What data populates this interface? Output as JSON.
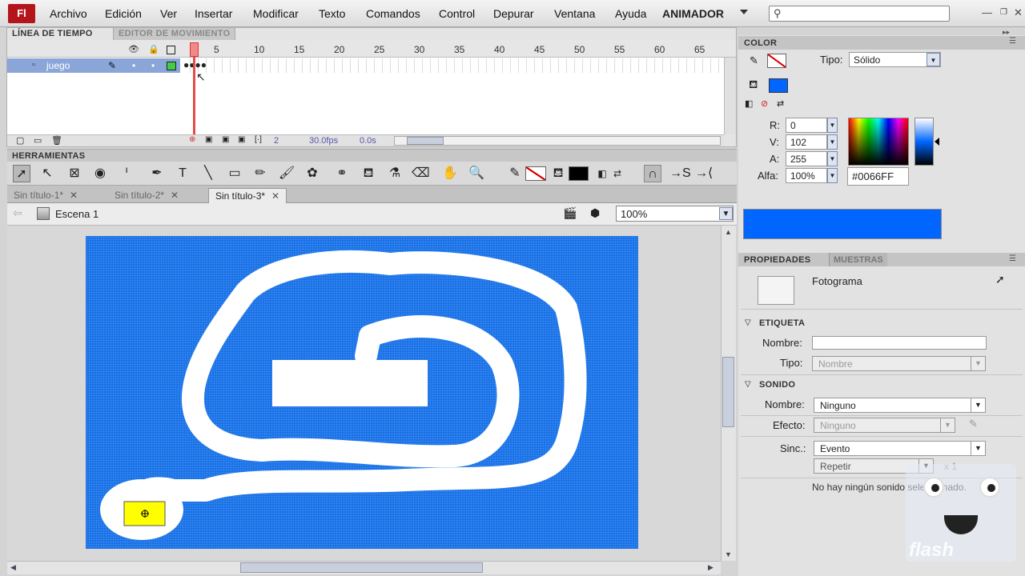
{
  "app": {
    "logo": "Fl",
    "workspace": "ANIMADOR"
  },
  "menu": [
    "Archivo",
    "Edición",
    "Ver",
    "Insertar",
    "Modificar",
    "Texto",
    "Comandos",
    "Control",
    "Depurar",
    "Ventana",
    "Ayuda"
  ],
  "timeline": {
    "tabs": [
      "LÍNEA DE TIEMPO",
      "EDITOR DE MOVIMIENTO"
    ],
    "frame_numbers": [
      "5",
      "10",
      "15",
      "20",
      "25",
      "30",
      "35",
      "40",
      "45",
      "50",
      "55",
      "60",
      "65"
    ],
    "layer_name": "juego",
    "fps": "30.0fps",
    "time": "0.0s",
    "current_frame": "2"
  },
  "tools": {
    "title": "HERRAMIENTAS"
  },
  "documents": [
    "Sin título-1*",
    "Sin título-2*",
    "Sin título-3*"
  ],
  "scene": {
    "name": "Escena 1",
    "zoom": "100%"
  },
  "color_panel": {
    "title": "COLOR",
    "tipo_label": "Tipo:",
    "tipo_value": "Sólido",
    "r_label": "R:",
    "r_value": "0",
    "v_label": "V:",
    "v_value": "102",
    "a_label": "A:",
    "a_value": "255",
    "alfa_label": "Alfa:",
    "alfa_value": "100%",
    "hex": "#0066FF",
    "fill_color": "#0066ff"
  },
  "properties": {
    "tabs": [
      "PROPIEDADES",
      "MUESTRAS"
    ],
    "object_type": "Fotograma",
    "etiqueta": {
      "title": "ETIQUETA",
      "nombre_label": "Nombre:",
      "nombre_value": "",
      "tipo_label": "Tipo:",
      "tipo_value": "Nombre"
    },
    "sonido": {
      "title": "SONIDO",
      "nombre_label": "Nombre:",
      "nombre_value": "Ninguno",
      "efecto_label": "Efecto:",
      "efecto_value": "Ninguno",
      "sinc_label": "Sinc.:",
      "sinc_value": "Evento",
      "repetir_value": "Repetir",
      "repeat_count": "x 1",
      "status": "No hay ningún sonido seleccionado."
    }
  },
  "watermark": "flash"
}
